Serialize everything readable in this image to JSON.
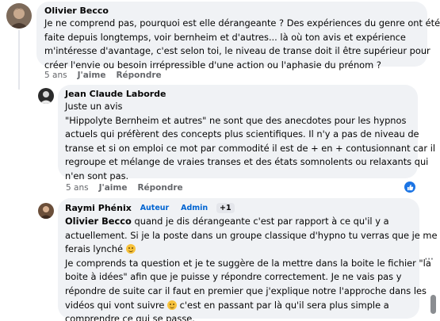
{
  "comments": [
    {
      "author": "Olivier Becco",
      "lines": [
        "Je ne comprend pas, pourquoi est elle dérangeante ? Des expériences du genre ont été",
        "faite depuis longtemps, voir bernheim et d'autres... là où ton avis et expérience",
        "m'intéresse d'avantage, c'est selon toi, le niveau de transe doit il être supérieur pour",
        "créer l'envie ou besoin irrépressible d'une action ou l'aphasie du prénom ?"
      ],
      "time": "5 ans",
      "like": "J'aime",
      "reply": "Répondre"
    },
    {
      "author": "Jean Claude Laborde",
      "lines": [
        "Juste un avis",
        "\"Hippolyte Bernheim et autres\" ne sont que des anecdotes pour les hypnos",
        "actuels qui préfèrent des concepts plus scientifiques. Il n'y a pas de niveau de",
        "transe et si on emploi ce mot par commodité il est de + en + contusionnant car il",
        "regroupe et mélange de vraies transes et des états somnolents ou relaxants qui",
        "n'en sont pas."
      ],
      "time": "5 ans",
      "like": "J'aime",
      "reply": "Répondre"
    },
    {
      "author": "Raymi Phénix",
      "badges": [
        "Auteur",
        "Admin",
        "+1"
      ],
      "mention": "Olivier Becco",
      "line1_rest": " quand je dis dérangeante c'est par rapport à ce qu'il y a",
      "lines_a": [
        "actuellement. Si je la poste dans un groupe classique d'hypno tu verras que je me",
        "ferais lynché"
      ],
      "lines_b": [
        "Je comprends ta question et je te suggère de la mettre dans la boite le fichier \"la",
        "boite à idées\" afin que je puisse y répondre correctement. Je ne vais pas y",
        "répondre de suite car il faut en premier que j'explique notre l'approche dans les",
        "vidéos qui vont suivre"
      ],
      "line_after_emoji": " c'est en passant par là qu'il sera plus simple a",
      "last_line": "comprendre ce qui se passe."
    }
  ],
  "colors": {
    "bubble": "#f0f2f5",
    "meta": "#65676b",
    "accent": "#1b74e4"
  },
  "icons": [
    "like-reaction-icon",
    "more-options-icon",
    "smile-emoji-icon"
  ]
}
